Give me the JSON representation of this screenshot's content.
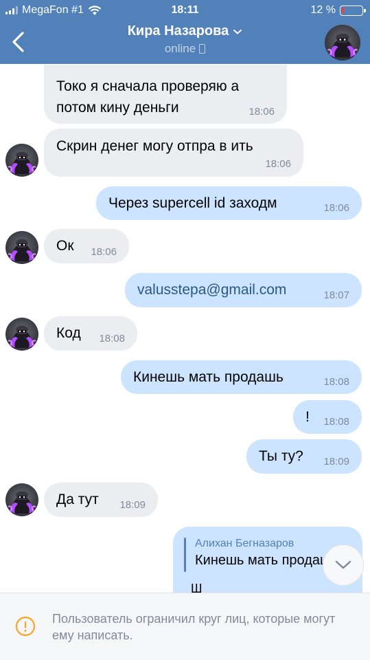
{
  "status_bar": {
    "carrier": "MegaFon #1",
    "time": "18:11",
    "battery_percent": "12 %",
    "battery_level": 0.12
  },
  "header": {
    "back_icon": "chevron-left-icon",
    "contact_name": "Кира Назарова",
    "presence": "online",
    "presence_icon": "mobile-phone-icon",
    "dropdown_icon": "chevron-down-icon"
  },
  "messages": [
    {
      "from": "in",
      "text": "Токо я сначала проверяю а\nпотом кину деньги",
      "time": "18:06"
    },
    {
      "from": "in",
      "text": "Скрин денег могу отпра в ить",
      "time": "18:06"
    },
    {
      "from": "out",
      "text": "Через supercell id заходм",
      "time": "18:06"
    },
    {
      "from": "in",
      "text": "Ок",
      "time": "18:06"
    },
    {
      "from": "out",
      "text": "valusstepa@gmail.com",
      "time": "18:07"
    },
    {
      "from": "in",
      "text": "Код",
      "time": "18:08"
    },
    {
      "from": "out",
      "text": "Кинешь мать продашь",
      "time": "18:08"
    },
    {
      "from": "out",
      "text": "!",
      "time": "18:08"
    },
    {
      "from": "out",
      "text": "Ты ту?",
      "time": "18:09"
    },
    {
      "from": "in",
      "text": "Да тут",
      "time": "18:09"
    }
  ],
  "reply_message": {
    "author": "Алихан Бегназаров",
    "quote": "Кинешь мать продашь",
    "partial_text": "Ш"
  },
  "footer": {
    "notice": "Пользователь ограничил круг лиц, которые могут ему написать.",
    "icon": "warning-icon"
  },
  "colors": {
    "header": "#5181b8",
    "incoming_bubble": "#ebedf0",
    "outgoing_bubble": "#cce4ff",
    "warning": "#f5a623"
  }
}
